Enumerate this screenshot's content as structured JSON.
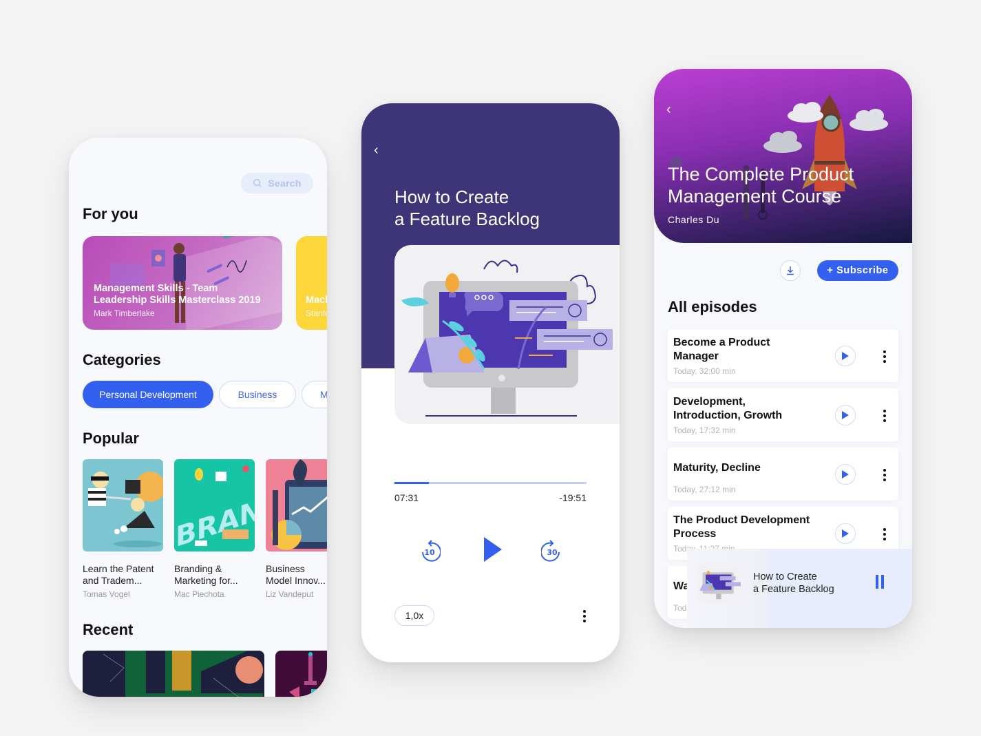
{
  "colors": {
    "background": "#f3f3f3",
    "accent": "#3460f0",
    "player_header": "#3d3577",
    "yellow_card": "#fdd63c",
    "muted_text": "#9a9a9a"
  },
  "browse_screen": {
    "search": {
      "icon": "search-icon",
      "label": "Search"
    },
    "for_you": {
      "heading": "For you",
      "cards": [
        {
          "title_line1": "Management Skills - Team",
          "title_line2": "Leadership Skills Masterclass 2019",
          "author": "Mark Timberlake"
        },
        {
          "title_line1": "Mach",
          "author": "Stanfo"
        }
      ]
    },
    "categories": {
      "heading": "Categories",
      "chips": [
        "Personal Development",
        "Business",
        "M"
      ],
      "selected": "Personal Development"
    },
    "popular": {
      "heading": "Popular",
      "items": [
        {
          "title_line1": "Learn the Patent",
          "title_line2": "and Tradem...",
          "author": "Tomas Vogel"
        },
        {
          "title_line1": "Branding &",
          "title_line2": "Marketing for...",
          "author": "Mac Piechota"
        },
        {
          "title_line1": "Business",
          "title_line2": "Model Innov...",
          "author": "Liz Vandeput"
        }
      ]
    },
    "recent": {
      "heading": "Recent"
    }
  },
  "player_screen": {
    "back_icon": "chevron-left-icon",
    "title_line1": "How to Create",
    "title_line2": "a Feature Backlog",
    "progress_fraction": 0.18,
    "elapsed": "07:31",
    "remaining": "-19:51",
    "rewind_label": "10",
    "forward_label": "30",
    "play_icon": "play-icon",
    "speed": "1,0x",
    "more_icon": "more-vertical-icon"
  },
  "course_screen": {
    "back_icon": "chevron-left-icon",
    "title_line1": "The Complete Product",
    "title_line2": "Management Course",
    "author": "Charles Du",
    "download_icon": "download-icon",
    "subscribe_label": "+ Subscribe",
    "episodes_heading": "All episodes",
    "episodes": [
      {
        "title": "Become a Product Manager",
        "meta": "Today, 32:00 min"
      },
      {
        "title": "Development, Introduction, Growth",
        "meta": "Today, 17:32 min"
      },
      {
        "title": "Maturity, Decline",
        "meta": "Today, 27:12 min"
      },
      {
        "title": "The Product Development Process",
        "meta": "Today, 11:27 min"
      },
      {
        "title": "Wa",
        "meta": "Tod"
      }
    ],
    "mini_player": {
      "title_line1": "How to Create",
      "title_line2": "a Feature Backlog",
      "pause_icon": "pause-icon"
    }
  }
}
